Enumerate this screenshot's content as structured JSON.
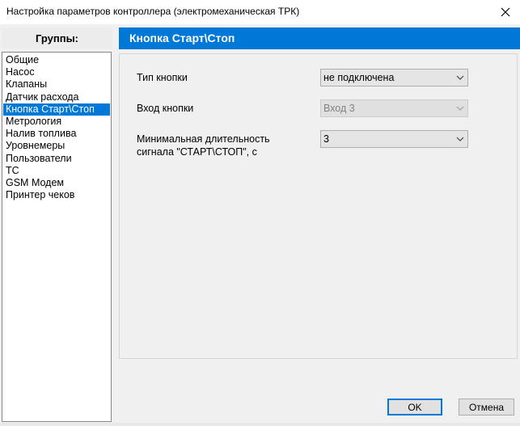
{
  "window": {
    "title": "Настройка параметров контроллера (электромеханическая ТРК)"
  },
  "sidebar": {
    "header": "Группы:",
    "items": [
      {
        "label": "Общие",
        "selected": false
      },
      {
        "label": "Насос",
        "selected": false
      },
      {
        "label": "Клапаны",
        "selected": false
      },
      {
        "label": "Датчик расхода",
        "selected": false
      },
      {
        "label": "Кнопка Старт\\Стоп",
        "selected": true
      },
      {
        "label": "Метрология",
        "selected": false
      },
      {
        "label": "Налив топлива",
        "selected": false
      },
      {
        "label": "Уровнемеры",
        "selected": false
      },
      {
        "label": "Пользователи",
        "selected": false
      },
      {
        "label": "ТС",
        "selected": false
      },
      {
        "label": "GSM Модем",
        "selected": false
      },
      {
        "label": "Принтер чеков",
        "selected": false
      }
    ]
  },
  "section": {
    "title": "Кнопка Старт\\Стоп"
  },
  "fields": {
    "button_type": {
      "label": "Тип кнопки",
      "value": "не подключена",
      "enabled": true
    },
    "button_input": {
      "label": "Вход кнопки",
      "value": "Вход 3",
      "enabled": false
    },
    "min_duration": {
      "label_line1": "Минимальная длительность",
      "label_line2": "сигнала \"СТАРТ\\СТОП\", с",
      "value": "3",
      "enabled": true
    }
  },
  "footer": {
    "ok_label": "OK",
    "cancel_label": "Отмена"
  },
  "colors": {
    "accent": "#0078d7",
    "window_bg": "#f0f0f0"
  }
}
